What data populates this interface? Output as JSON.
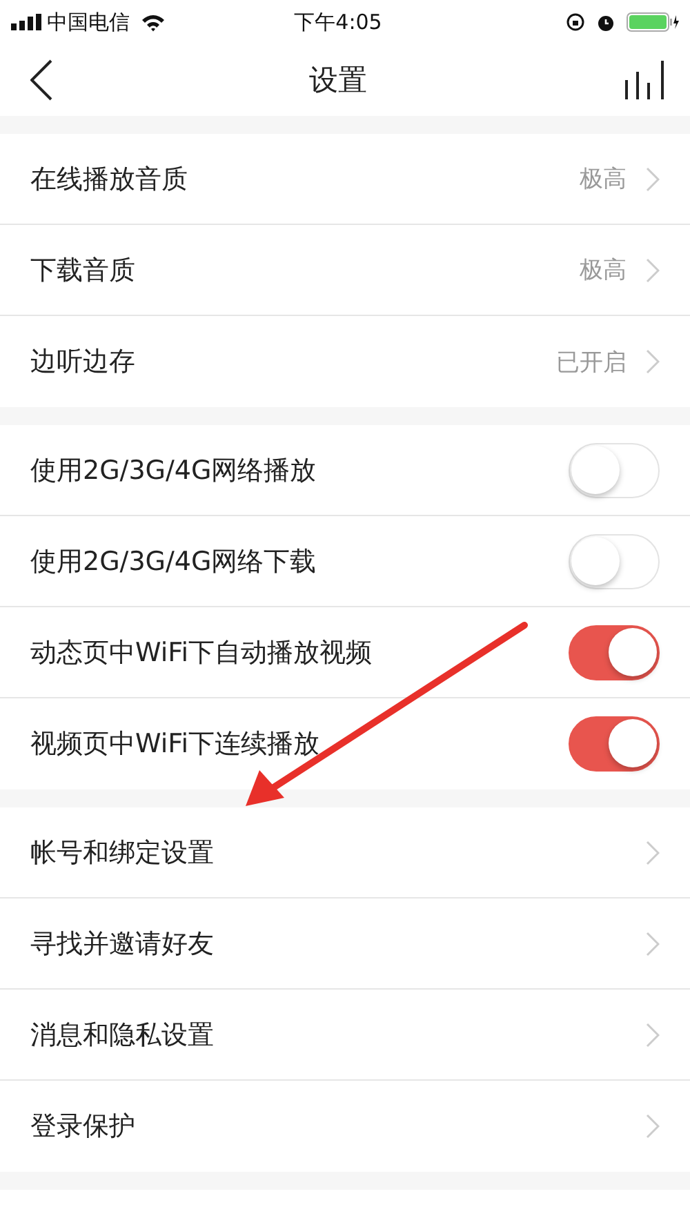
{
  "status_bar": {
    "carrier": "中国电信",
    "time": "下午4:05"
  },
  "nav": {
    "title": "设置"
  },
  "groups": [
    {
      "items": [
        {
          "kind": "link",
          "label": "在线播放音质",
          "value": "极高"
        },
        {
          "kind": "link",
          "label": "下载音质",
          "value": "极高"
        },
        {
          "kind": "link",
          "label": "边听边存",
          "value": "已开启"
        }
      ]
    },
    {
      "items": [
        {
          "kind": "toggle",
          "label": "使用2G/3G/4G网络播放",
          "on": false
        },
        {
          "kind": "toggle",
          "label": "使用2G/3G/4G网络下载",
          "on": false
        },
        {
          "kind": "toggle",
          "label": "动态页中WiFi下自动播放视频",
          "on": true
        },
        {
          "kind": "toggle",
          "label": "视频页中WiFi下连续播放",
          "on": true
        }
      ]
    },
    {
      "items": [
        {
          "kind": "link",
          "label": "帐号和绑定设置"
        },
        {
          "kind": "link",
          "label": "寻找并邀请好友"
        },
        {
          "kind": "link",
          "label": "消息和隐私设置"
        },
        {
          "kind": "link",
          "label": "登录保护"
        }
      ]
    }
  ]
}
